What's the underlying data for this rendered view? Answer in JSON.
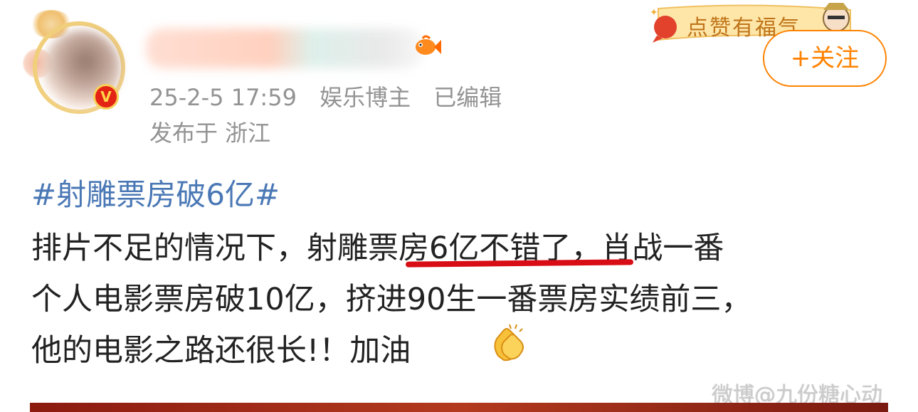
{
  "post": {
    "meta": {
      "date": "25-2-5 17:59",
      "category": "娱乐博主",
      "edited": "已编辑",
      "location": "发布于 浙江"
    },
    "follow_label": "+关注",
    "banner_text": "点赞有福气",
    "hashtag": "#射雕票房破6亿#",
    "lines": [
      "排片不足的情况下，射雕票房6亿不错了，肖战一番",
      "个人电影票房破10亿，挤进90生一番票房实绩前三，",
      "他的电影之路还很长!！加油"
    ],
    "watermark": "微博@九份糖心动"
  },
  "icons": {
    "verified": "verified-v-icon",
    "fish": "fish-icon",
    "clap": "clapping-hands-icon"
  },
  "colors": {
    "hashtag": "#4a78b5",
    "follow": "#ff8200",
    "underline": "#d80d15"
  }
}
